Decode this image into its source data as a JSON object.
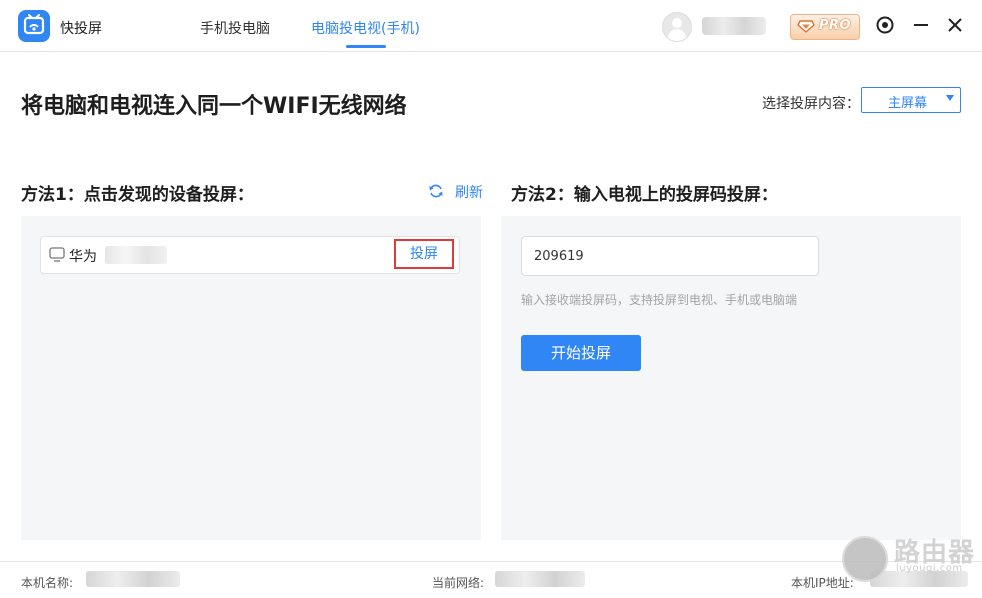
{
  "app": {
    "name": "快投屏"
  },
  "tabs": [
    {
      "label": "手机投电脑",
      "active": false
    },
    {
      "label": "电脑投电视(手机)",
      "active": true
    }
  ],
  "header": {
    "pro_label": "PRO"
  },
  "main": {
    "heading": "将电脑和电视连入同一个WIFI无线网络",
    "select_label": "选择投屏内容：",
    "select_value": "主屏幕"
  },
  "method1": {
    "title": "方法1：点击发现的设备投屏：",
    "refresh_label": "刷新",
    "devices": [
      {
        "name": "华为",
        "action_label": "投屏"
      }
    ]
  },
  "method2": {
    "title": "方法2：输入电视上的投屏码投屏：",
    "code_value": "209619",
    "hint": "输入接收端投屏码，支持投屏到电视、手机或电脑端",
    "start_label": "开始投屏"
  },
  "footer": {
    "device_name_label": "本机名称:",
    "network_label": "当前网络:",
    "ip_label": "本机IP地址:"
  },
  "watermark": {
    "title": "路由器",
    "subtitle": "luyouqi.com"
  },
  "colors": {
    "accent": "#2f86f4",
    "highlight_border": "#e03b3b",
    "panel_bg": "#f5f6f8"
  }
}
